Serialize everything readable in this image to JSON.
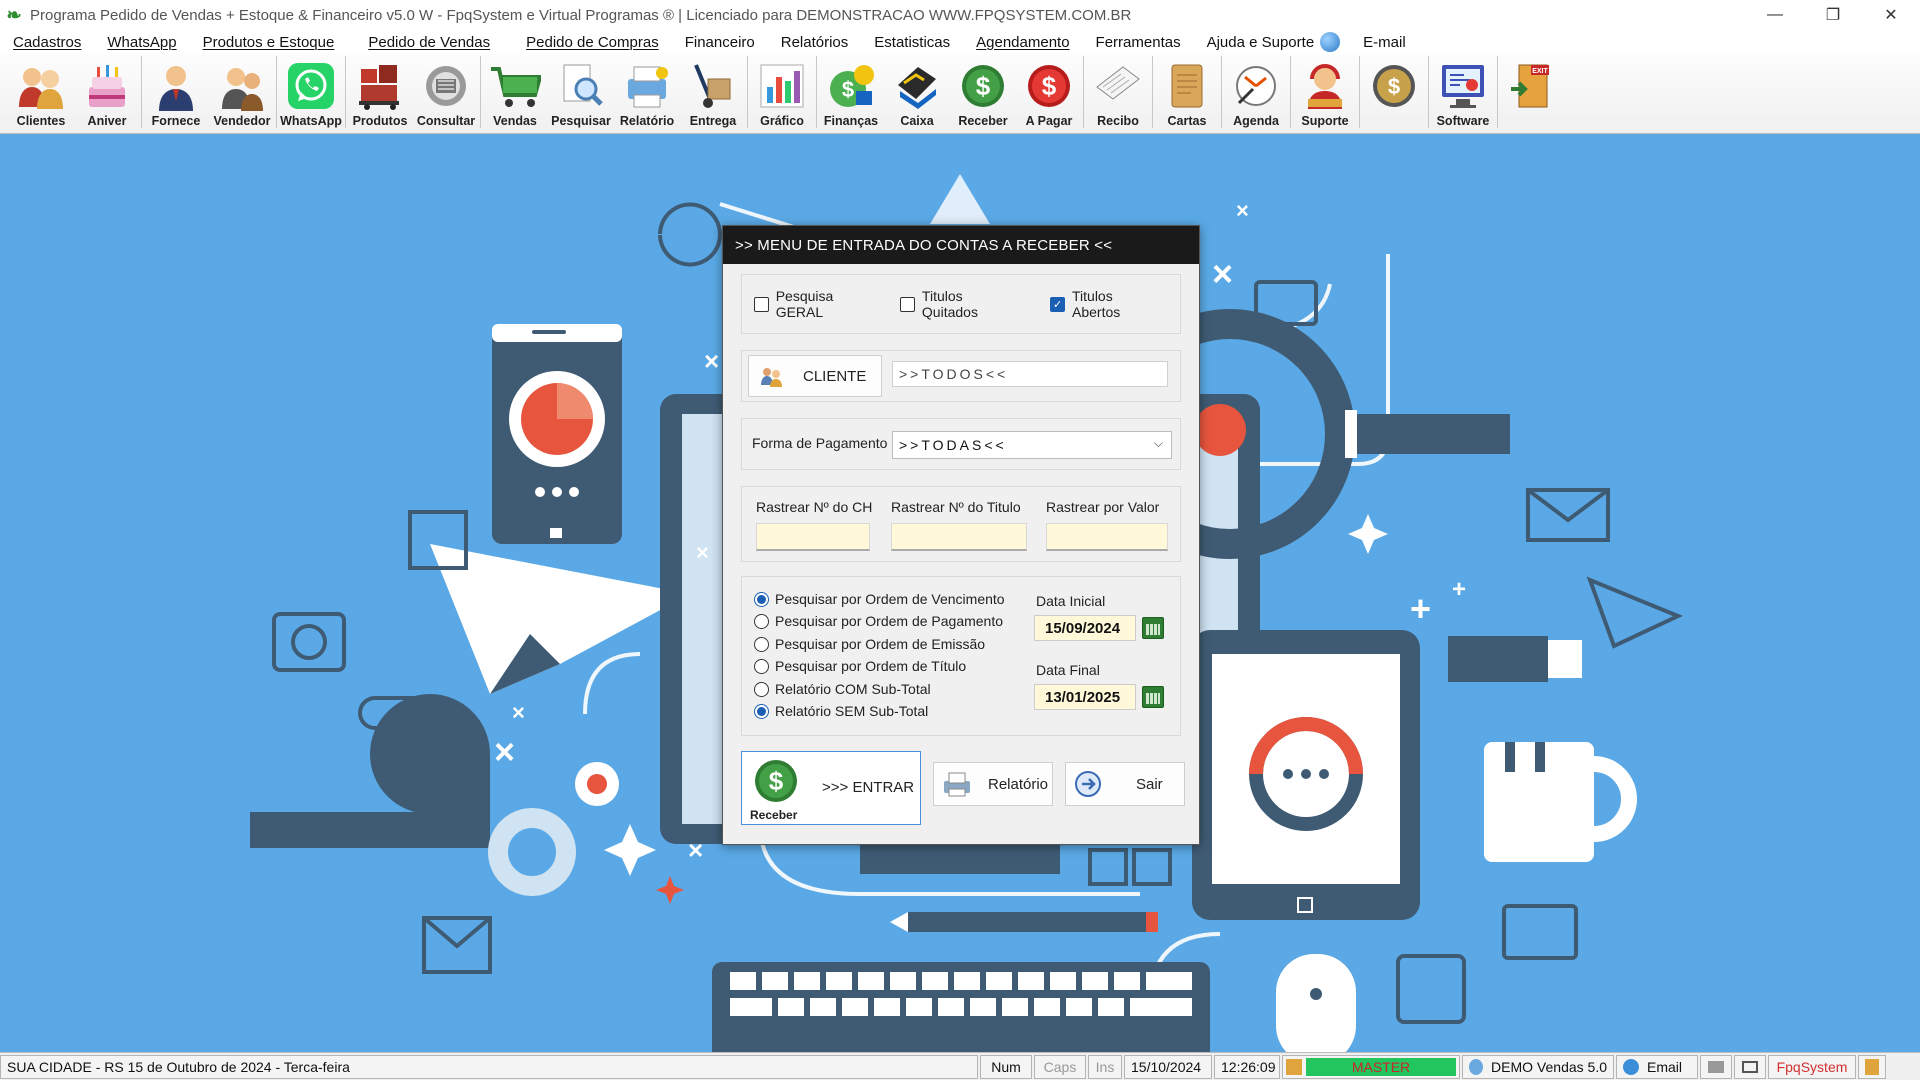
{
  "window": {
    "title": "Programa Pedido de Vendas + Estoque & Financeiro v5.0 W - FpqSystem e Virtual Programas ® | Licenciado para  DEMONSTRACAO WWW.FPQSYSTEM.COM.BR",
    "minimize": "—",
    "restore": "❐",
    "close": "✕"
  },
  "menu": [
    "Cadastros",
    "WhatsApp",
    "Produtos e Estoque",
    "Pedido de Vendas",
    "Pedido de Compras",
    "Financeiro",
    "Relatórios",
    "Estatisticas",
    "Agendamento",
    "Ferramentas",
    "Ajuda e Suporte",
    "E-mail"
  ],
  "toolbar": [
    "Clientes",
    "Aniver",
    "Fornece",
    "Vendedor",
    "WhatsApp",
    "Produtos",
    "Consultar",
    "Vendas",
    "Pesquisar",
    "Relatório",
    "Entrega",
    "Gráfico",
    "Finanças",
    "Caixa",
    "Receber",
    "A Pagar",
    "Recibo",
    "Cartas",
    "Agenda",
    "Suporte",
    "",
    "Software",
    ""
  ],
  "dialog": {
    "title": ">>  MENU DE ENTRADA DO CONTAS A RECEBER  <<",
    "checks": [
      {
        "label": "Pesquisa GERAL",
        "checked": false
      },
      {
        "label": "Titulos Quitados",
        "checked": false
      },
      {
        "label": "Titulos Abertos",
        "checked": true
      }
    ],
    "cliente_button": "CLIENTE",
    "cliente_value": ">>TODOS<<",
    "forma_label": "Forma de Pagamento",
    "forma_value": ">>TODAS<<",
    "rastrear": [
      "Rastrear Nº do CH",
      "Rastrear Nº do Titulo",
      "Rastrear por Valor"
    ],
    "radios": [
      {
        "label": "Pesquisar por Ordem de Vencimento",
        "selected": true
      },
      {
        "label": "Pesquisar por Ordem de Pagamento",
        "selected": false
      },
      {
        "label": "Pesquisar por Ordem de Emissão",
        "selected": false
      },
      {
        "label": "Pesquisar por Ordem de Título",
        "selected": false
      },
      {
        "label": "Relatório COM Sub-Total",
        "selected": false
      },
      {
        "label": "Relatório SEM Sub-Total",
        "selected": true
      }
    ],
    "data_inicial_label": "Data Inicial",
    "data_inicial": "15/09/2024",
    "data_final_label": "Data Final",
    "data_final": "13/01/2025",
    "entrar_label": ">>> ENTRAR",
    "receber_label": "Receber",
    "relatorio_label": "Relatório",
    "sair_label": "Sair"
  },
  "status": {
    "city": "SUA CIDADE - RS 15 de Outubro de 2024 - Terca-feira",
    "num": "Num",
    "caps": "Caps",
    "ins": "Ins",
    "date": "15/10/2024",
    "time": "12:26:09",
    "user": "MASTER",
    "version": "DEMO Vendas 5.0",
    "email": "Email",
    "brand": "FpqSystem"
  },
  "colors": {
    "desktop": "#5aa9e6",
    "accent": "#1a5fb4",
    "master_bar": "#22c55e",
    "brand_red": "#d32f2f"
  }
}
